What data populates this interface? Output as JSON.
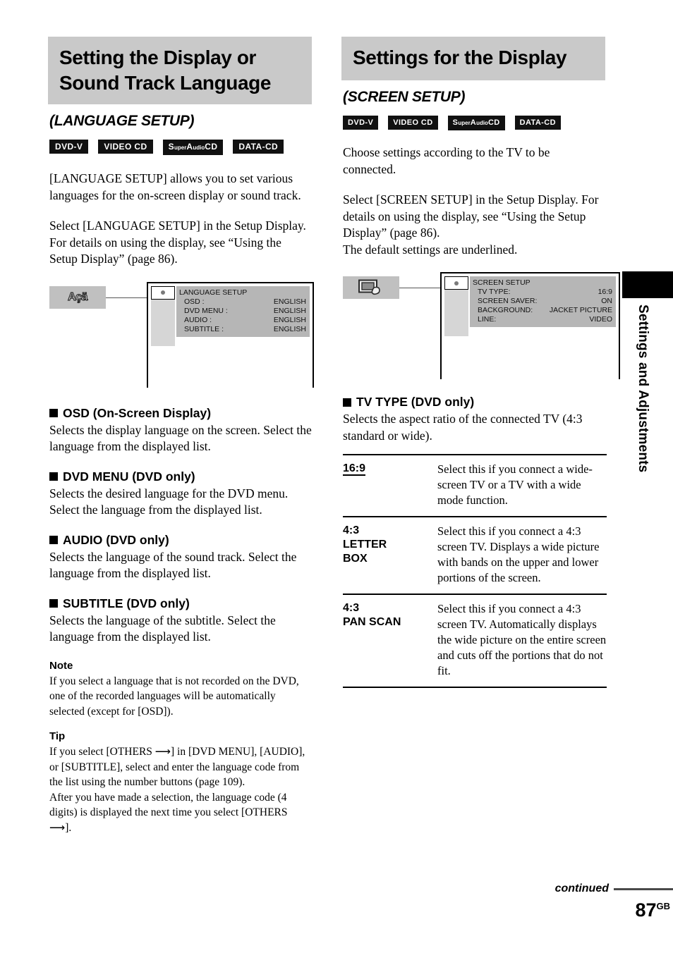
{
  "page": {
    "number": "87",
    "number_suffix": "GB",
    "continued_label": "continued",
    "side_tab": "Settings and Adjustments"
  },
  "left": {
    "title": "Setting the Display or Sound Track Language",
    "subtitle": "(LANGUAGE SETUP)",
    "badges": [
      {
        "main": "DVD-V"
      },
      {
        "main": "VIDEO CD"
      },
      {
        "main": "SuperAudioCD",
        "s": "S",
        "uper": "uper",
        "a": "A",
        "udio": "udio",
        "cd": "CD"
      },
      {
        "main": "DATA-CD"
      }
    ],
    "intro1": "[LANGUAGE SETUP] allows you to set various languages for the on-screen display or sound track.",
    "intro2": "Select [LANGUAGE SETUP] in the Setup Display. For details on using the display, see “Using the Setup Display” (page 86).",
    "illustration": {
      "icon_glyph": "Açä",
      "screen_title": "LANGUAGE SETUP",
      "rows": [
        {
          "key": "OSD :",
          "value": "ENGLISH"
        },
        {
          "key": "DVD MENU :",
          "value": "ENGLISH"
        },
        {
          "key": "AUDIO :",
          "value": "ENGLISH"
        },
        {
          "key": "SUBTITLE :",
          "value": "ENGLISH"
        }
      ]
    },
    "sections": [
      {
        "heading": "OSD (On-Screen Display)",
        "body": "Selects the display language on the screen. Select the language from the displayed list."
      },
      {
        "heading": "DVD MENU (DVD only)",
        "body": "Selects the desired language for the DVD menu. Select the language from the displayed list."
      },
      {
        "heading": "AUDIO (DVD only)",
        "body": "Selects the language of the sound track. Select the language from the displayed list."
      },
      {
        "heading": "SUBTITLE (DVD only)",
        "body": "Selects the language of the subtitle. Select the language from the displayed list."
      }
    ],
    "note_heading": "Note",
    "note_body": "If you select a language that is not recorded on the DVD, one of the recorded languages will be automatically selected (except for [OSD]).",
    "tip_heading": "Tip",
    "tip_body_1": "If you select [OTHERS ⟶] in [DVD MENU], [AUDIO], or [SUBTITLE], select and enter the language code from the list using the number buttons (page 109).",
    "tip_body_2": "After you have made a selection, the language code (4 digits) is displayed the next time you select [OTHERS ⟶]."
  },
  "right": {
    "title": "Settings for the Display",
    "subtitle": "(SCREEN SETUP)",
    "badges": [
      {
        "main": "DVD-V"
      },
      {
        "main": "VIDEO CD"
      },
      {
        "main": "SuperAudioCD"
      },
      {
        "main": "DATA-CD"
      }
    ],
    "intro1": "Choose settings according to the TV to be connected.",
    "intro2": "Select [SCREEN SETUP] in the Setup Display. For details on using the display, see “Using the Setup Display” (page 86).",
    "intro3": "The default settings are underlined.",
    "illustration": {
      "icon_glyph": "tv-monitor",
      "screen_title": "SCREEN SETUP",
      "rows": [
        {
          "key": "TV TYPE:",
          "value": "16:9"
        },
        {
          "key": "SCREEN SAVER:",
          "value": "ON"
        },
        {
          "key": "BACKGROUND:",
          "value": "JACKET PICTURE"
        },
        {
          "key": "LINE:",
          "value": "VIDEO"
        }
      ]
    },
    "section": {
      "heading": "TV TYPE (DVD only)",
      "body": "Selects the aspect ratio of the connected TV (4:3 standard or wide)."
    },
    "table": [
      {
        "key": "16:9",
        "key_lines": [
          "16:9"
        ],
        "default": true,
        "desc": "Select this if you connect a wide-screen TV or a TV with a wide mode function."
      },
      {
        "key": "4:3 LETTER BOX",
        "key_lines": [
          "4:3",
          "LETTER",
          "BOX"
        ],
        "default": false,
        "desc": "Select this if you connect a 4:3 screen TV. Displays a wide picture with bands on the upper and lower portions of the screen."
      },
      {
        "key": "4:3 PAN SCAN",
        "key_lines": [
          "4:3",
          "PAN SCAN"
        ],
        "default": false,
        "desc": "Select this if you connect a 4:3 screen TV. Automatically displays the wide picture on the entire screen and cuts off the portions that do not fit."
      }
    ]
  }
}
